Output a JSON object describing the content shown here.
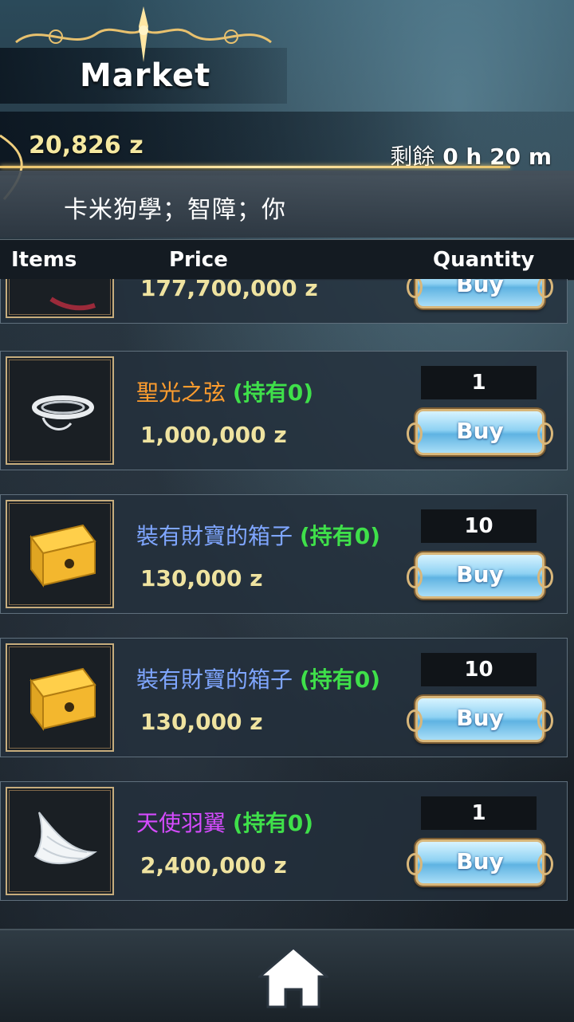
{
  "header": {
    "title": "Market",
    "money": "20,826 z",
    "timer_label": "剩餘",
    "timer_value": "0 h 20 m",
    "message": "卡米狗學；智障；你"
  },
  "columns": {
    "items": "Items",
    "price": "Price",
    "quantity": "Quantity"
  },
  "items": [
    {
      "name": "",
      "owned": "",
      "price": "177,700,000 z",
      "quantity": "",
      "buy": "Buy",
      "name_color": "#ffffff",
      "icon": "partial-item-icon"
    },
    {
      "name": "聖光之弦",
      "owned": "(持有0)",
      "price": "1,000,000 z",
      "quantity": "1",
      "buy": "Buy",
      "name_color": "#ff9d2e",
      "icon": "string-icon"
    },
    {
      "name": "裝有財寶的箱子",
      "owned": "(持有0)",
      "price": "130,000 z",
      "quantity": "10",
      "buy": "Buy",
      "name_color": "#7fa6ff",
      "icon": "treasure-box-icon"
    },
    {
      "name": "裝有財寶的箱子",
      "owned": "(持有0)",
      "price": "130,000 z",
      "quantity": "10",
      "buy": "Buy",
      "name_color": "#7fa6ff",
      "icon": "treasure-box-icon"
    },
    {
      "name": "天使羽翼",
      "owned": "(持有0)",
      "price": "2,400,000 z",
      "quantity": "1",
      "buy": "Buy",
      "name_color": "#d64bff",
      "icon": "angel-wing-icon"
    }
  ],
  "footer": {
    "home_icon": "home-icon"
  }
}
